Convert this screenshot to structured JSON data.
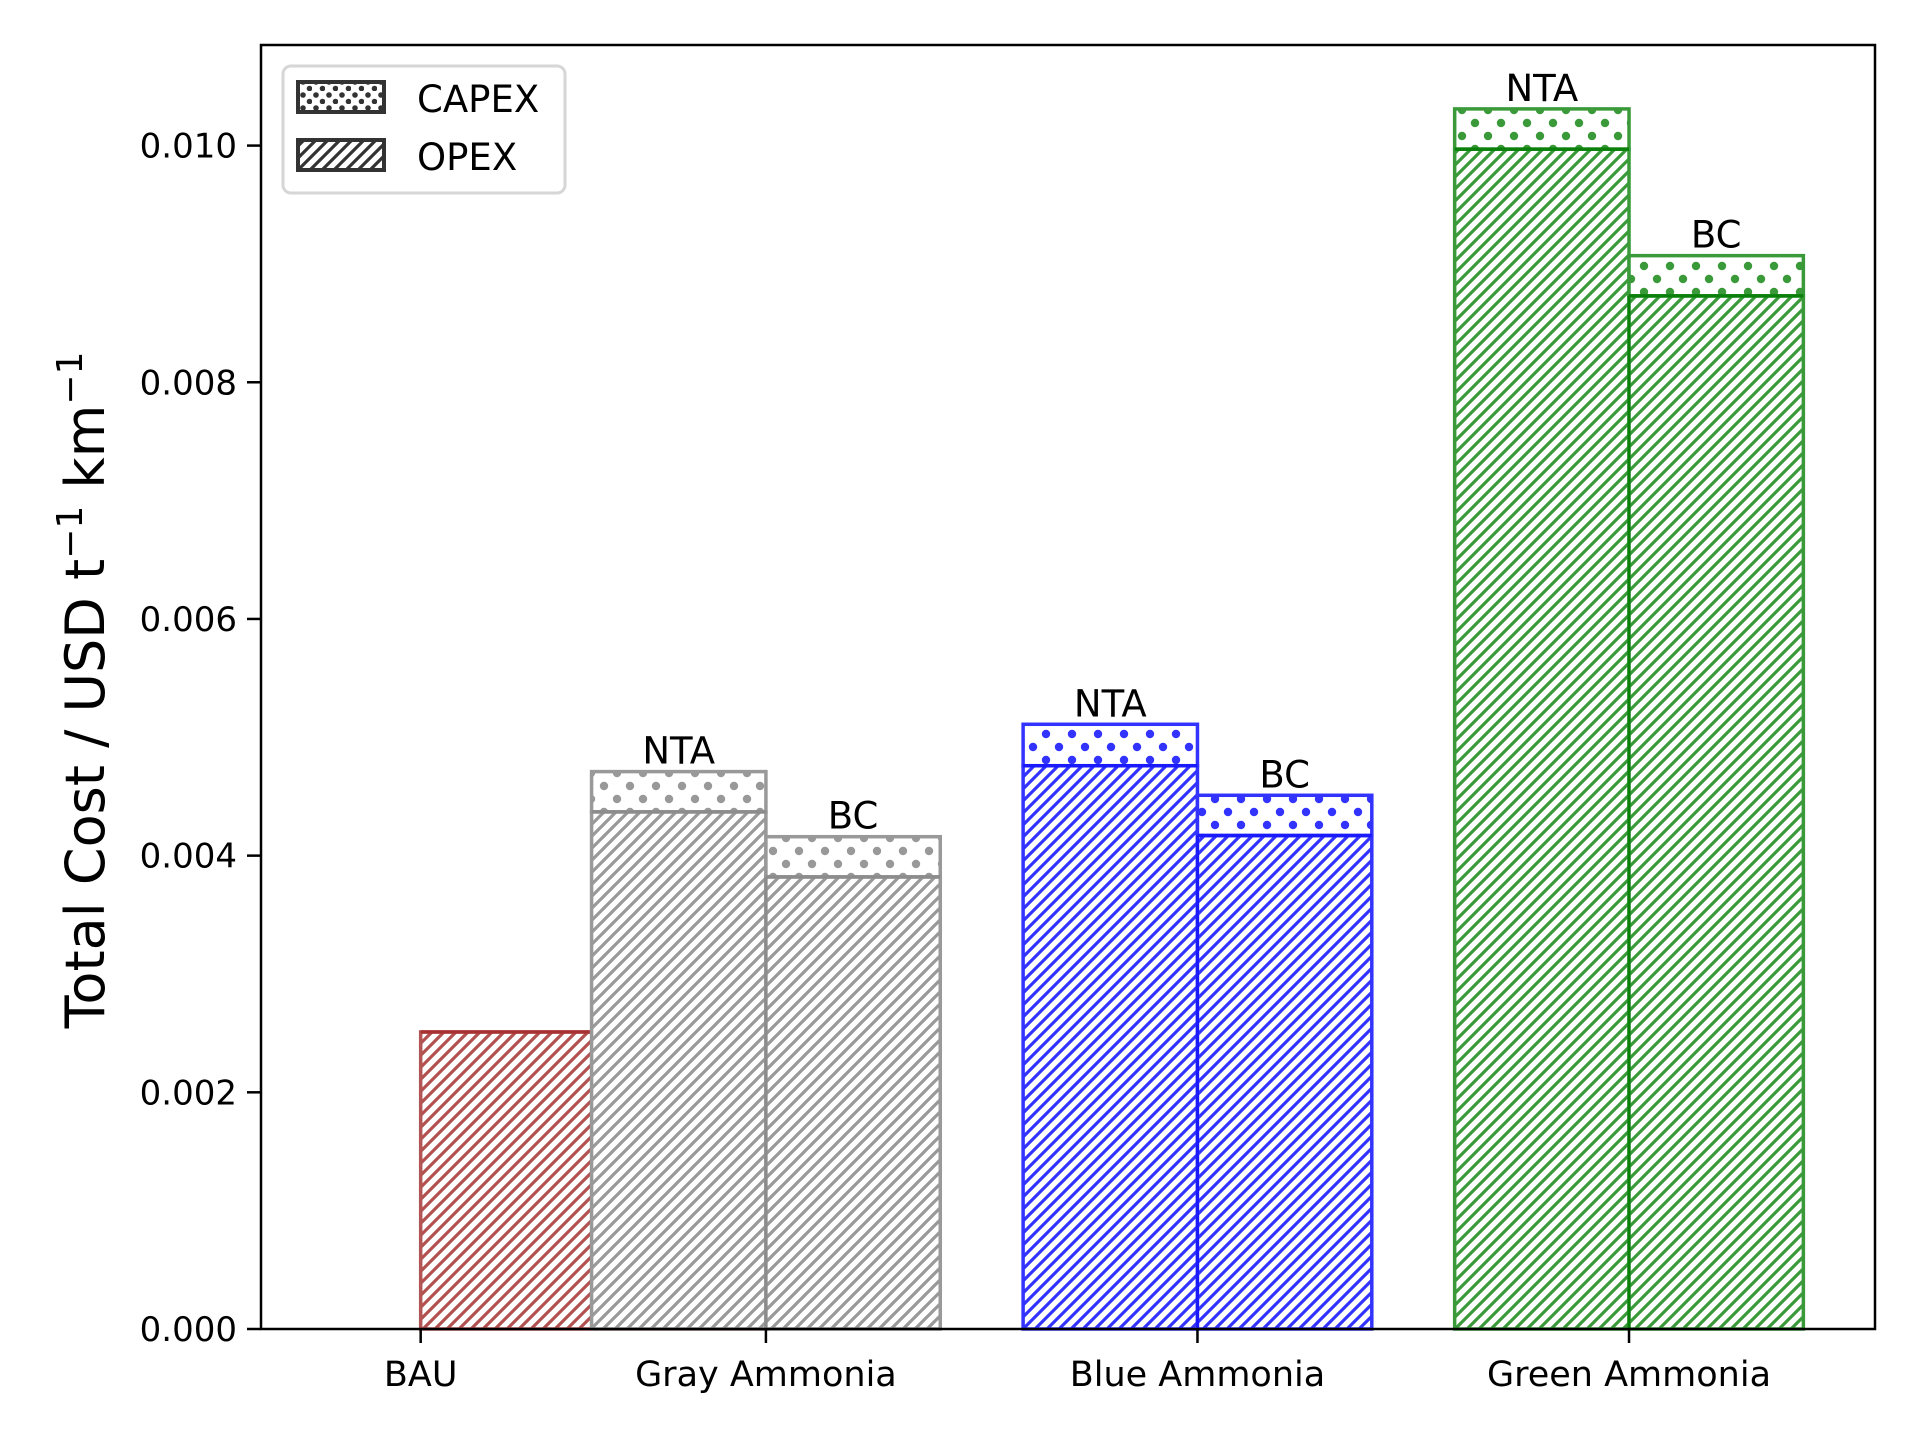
{
  "chart_data": {
    "type": "bar",
    "stacked": true,
    "title": "",
    "xlabel": "",
    "ylabel": "Total Cost / USD t⁻¹ km⁻¹",
    "ylabel_parts": {
      "main": "Total Cost  /  USD t",
      "sup1": "−1",
      "mid": " km",
      "sup2": "−1"
    },
    "ylim": [
      0,
      0.01085
    ],
    "yticks": [
      0.0,
      0.002,
      0.004,
      0.006,
      0.008,
      0.01
    ],
    "ytick_labels": [
      "0.000",
      "0.002",
      "0.004",
      "0.006",
      "0.008",
      "0.010"
    ],
    "xlim": [
      -0.17,
      3.57
    ],
    "categories": [
      "BAU",
      "Gray Ammonia",
      "Blue Ammonia",
      "Green Ammonia"
    ],
    "category_positions": [
      0.2,
      1,
      2,
      3
    ],
    "bar_width": 0.404,
    "grid": false,
    "legend": {
      "placement": "top-left",
      "entries": [
        {
          "label": "CAPEX",
          "pattern": "dots"
        },
        {
          "label": "OPEX",
          "pattern": "hatch"
        }
      ]
    },
    "groups": [
      {
        "category": "BAU",
        "color": "#b35050",
        "edge": "#b35555",
        "divider": "#a83232",
        "bars": [
          {
            "label": "",
            "opex": 0.00251,
            "capex": 0.0,
            "offset": 0
          },
          {
            "label": "",
            "opex": 0.0,
            "capex": 0.0,
            "offset": 1
          }
        ]
      },
      {
        "category": "Gray Ammonia",
        "color": "#999999",
        "edge": "#999999",
        "divider": "#8c8c8c",
        "bars": [
          {
            "label": "NTA",
            "opex": 0.00437,
            "capex": 0.00034,
            "offset": -1
          },
          {
            "label": "BC",
            "opex": 0.00382,
            "capex": 0.00034,
            "offset": 0
          }
        ]
      },
      {
        "category": "Blue Ammonia",
        "color": "#3333ff",
        "edge": "#3333ff",
        "divider": "#1a1aff",
        "bars": [
          {
            "label": "NTA",
            "opex": 0.00476,
            "capex": 0.00035,
            "offset": -1
          },
          {
            "label": "BC",
            "opex": 0.00417,
            "capex": 0.00034,
            "offset": 0
          }
        ]
      },
      {
        "category": "Green Ammonia",
        "color": "#3a9a3a",
        "edge": "#3a9a3a",
        "divider": "#0a800a",
        "bars": [
          {
            "label": "NTA",
            "opex": 0.00997,
            "capex": 0.00034,
            "offset": -1
          },
          {
            "label": "BC",
            "opex": 0.00873,
            "capex": 0.00034,
            "offset": 0
          }
        ]
      }
    ]
  }
}
